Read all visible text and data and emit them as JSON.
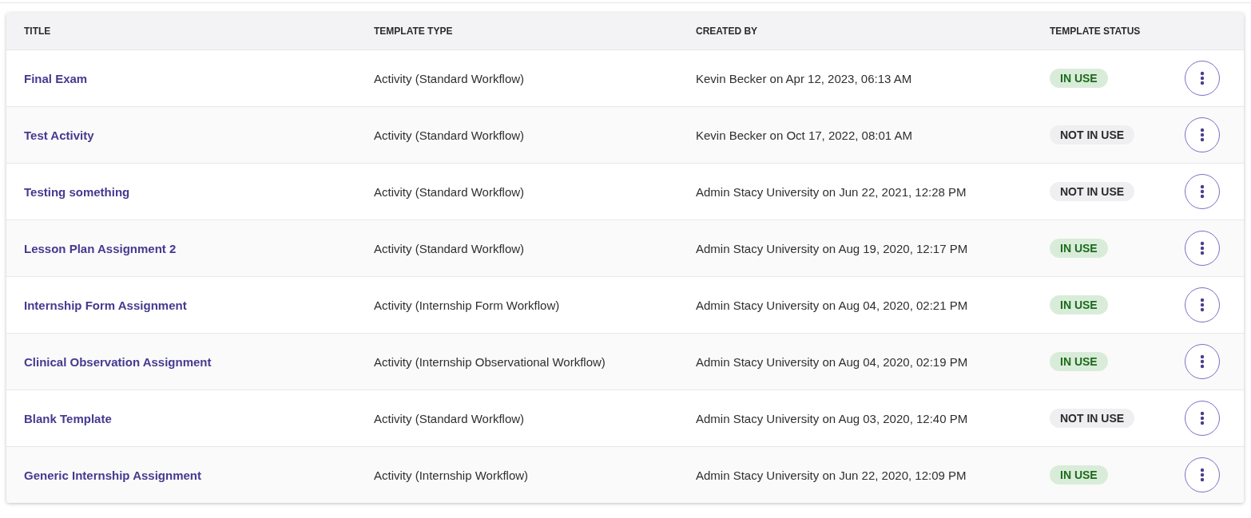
{
  "table": {
    "columns": [
      "TITLE",
      "TEMPLATE TYPE",
      "CREATED BY",
      "TEMPLATE STATUS"
    ],
    "rows": [
      {
        "title": "Final Exam",
        "type": "Activity (Standard Workflow)",
        "created_by": "Kevin Becker on Apr 12, 2023, 06:13 AM",
        "status": {
          "label": "IN USE",
          "kind": "in_use"
        }
      },
      {
        "title": "Test Activity",
        "type": "Activity (Standard Workflow)",
        "created_by": "Kevin Becker on Oct 17, 2022, 08:01 AM",
        "status": {
          "label": "NOT IN USE",
          "kind": "not_in_use"
        }
      },
      {
        "title": "Testing something",
        "type": "Activity (Standard Workflow)",
        "created_by": "Admin Stacy University on Jun 22, 2021, 12:28 PM",
        "status": {
          "label": "NOT IN USE",
          "kind": "not_in_use"
        }
      },
      {
        "title": "Lesson Plan Assignment 2",
        "type": "Activity (Standard Workflow)",
        "created_by": "Admin Stacy University on Aug 19, 2020, 12:17 PM",
        "status": {
          "label": "IN USE",
          "kind": "in_use"
        }
      },
      {
        "title": "Internship Form Assignment",
        "type": "Activity (Internship Form Workflow)",
        "created_by": "Admin Stacy University on Aug 04, 2020, 02:21 PM",
        "status": {
          "label": "IN USE",
          "kind": "in_use"
        }
      },
      {
        "title": "Clinical Observation Assignment",
        "type": "Activity (Internship Observational Workflow)",
        "created_by": "Admin Stacy University on Aug 04, 2020, 02:19 PM",
        "status": {
          "label": "IN USE",
          "kind": "in_use"
        }
      },
      {
        "title": "Blank Template",
        "type": "Activity (Standard Workflow)",
        "created_by": "Admin Stacy University on Aug 03, 2020, 12:40 PM",
        "status": {
          "label": "NOT IN USE",
          "kind": "not_in_use"
        }
      },
      {
        "title": "Generic Internship Assignment",
        "type": "Activity (Internship Workflow)",
        "created_by": "Admin Stacy University on Jun 22, 2020, 12:09 PM",
        "status": {
          "label": "IN USE",
          "kind": "in_use"
        }
      }
    ]
  }
}
